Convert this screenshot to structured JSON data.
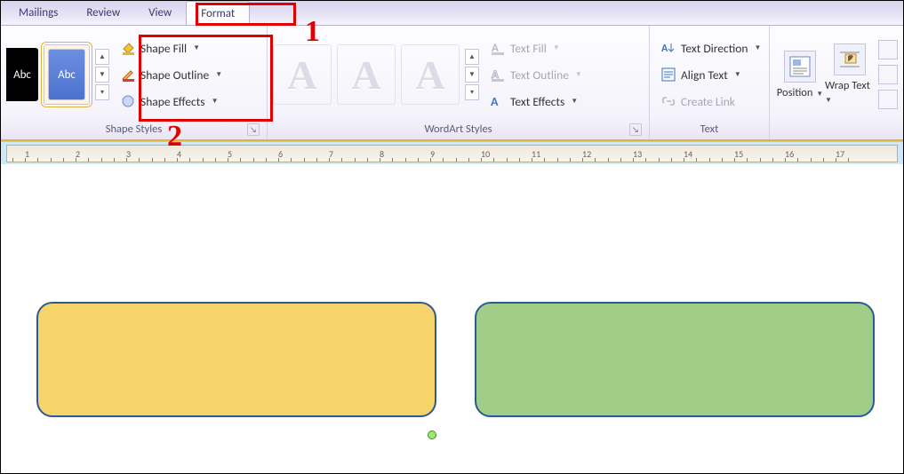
{
  "tabs": {
    "mailings": "Mailings",
    "review": "Review",
    "view": "View",
    "format": "Format"
  },
  "groups": {
    "shape_styles": {
      "title": "Shape Styles",
      "swatch_text": "Abc",
      "fill": "Shape Fill",
      "outline": "Shape Outline",
      "effects": "Shape Effects"
    },
    "wordart": {
      "title": "WordArt Styles",
      "glyph": "A",
      "text_fill": "Text Fill",
      "text_outline": "Text Outline",
      "text_effects": "Text Effects"
    },
    "text": {
      "title": "Text",
      "direction": "Text Direction",
      "align": "Align Text",
      "link": "Create Link"
    },
    "arrange": {
      "position": "Position",
      "wrap": "Wrap Text"
    }
  },
  "callouts": {
    "one": "1",
    "two": "2"
  },
  "ruler_nums": [
    "1",
    "2",
    "3",
    "4",
    "5",
    "6",
    "7",
    "8",
    "9",
    "10",
    "11",
    "12",
    "13",
    "14",
    "15",
    "16",
    "17"
  ]
}
